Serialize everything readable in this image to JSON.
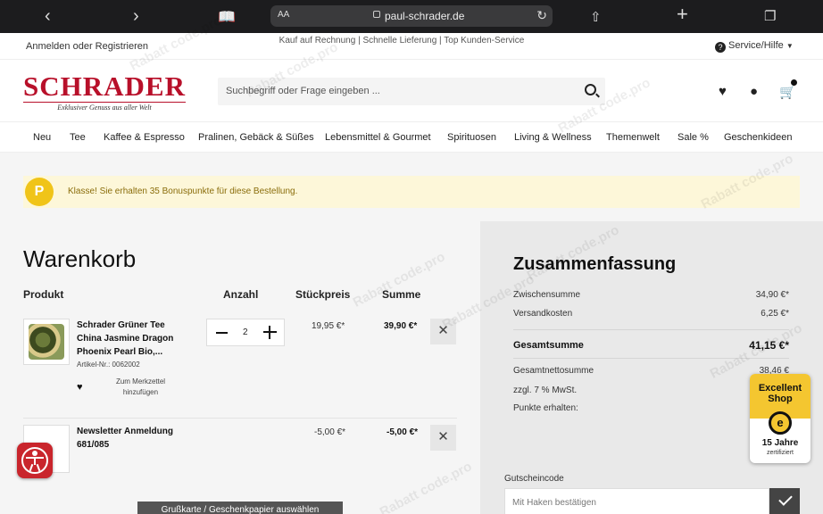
{
  "browser": {
    "text_size_label": "AA",
    "url": "paul-schrader.de",
    "icons": [
      "back-icon",
      "forward-icon",
      "bookmarks-icon",
      "lock-icon",
      "reload-icon",
      "share-icon",
      "new-tab-icon",
      "tabs-icon"
    ]
  },
  "utility": {
    "login": "Anmelden oder Registrieren",
    "promo": "Kauf auf Rechnung | Schnelle Lieferung | Top Kunden-Service",
    "service": "Service/Hilfe"
  },
  "header": {
    "logo_word": "SCHRADER",
    "logo_tagline": "Exklusiver Genuss aus aller Welt",
    "search_placeholder": "Suchbegriff oder Frage eingeben ..."
  },
  "nav": [
    "Neu",
    "Tee",
    "Kaffee & Espresso",
    "Pralinen, Gebäck & Süßes",
    "Lebensmittel & Gourmet",
    "Spirituosen",
    "Living & Wellness",
    "Themenwelt",
    "Sale %",
    "Geschenkideen"
  ],
  "bonus": {
    "badge": "P",
    "text": "Klasse! Sie erhalten 35 Bonuspunkte für diese Bestellung.",
    "bg_color": "#fdf7d9",
    "badge_color": "#f0c419"
  },
  "cart": {
    "title": "Warenkorb",
    "columns": {
      "product": "Produkt",
      "quantity": "Anzahl",
      "unit_price": "Stückpreis",
      "total": "Summe"
    },
    "items": [
      {
        "name_lines": [
          "Schrader Grüner Tee",
          "China Jasmine Dragon",
          "Phoenix Pearl Bio,..."
        ],
        "article": "Artikel-Nr.: 0062002",
        "wishlist_lines": [
          "Zum Merkzettel",
          "hinzufügen"
        ],
        "quantity": "2",
        "unit_price": "19,95 €*",
        "total": "39,90 €*"
      },
      {
        "name_lines": [
          "Newsletter Anmeldung",
          "681/085"
        ],
        "unit_price": "-5,00 €*",
        "total": "-5,00 €*"
      }
    ],
    "gift_button": "Grußkarte / Geschenkpapier auswählen"
  },
  "summary": {
    "title": "Zusammenfassung",
    "subtotal_label": "Zwischensumme",
    "subtotal": "34,90 €*",
    "shipping_label": "Versandkosten",
    "shipping": "6,25 €*",
    "total_label": "Gesamtsumme",
    "total": "41,15 €*",
    "net_label": "Gesamtnettosumme",
    "net": "38,46 €",
    "vat_label": "zzgl. 7 % MwSt.",
    "points_label": "Punkte erhalten:",
    "coupon_label": "Gutscheincode",
    "coupon_placeholder": "Mit Haken bestätigen"
  },
  "badge": {
    "line1": "Excellent",
    "line2": "Shop",
    "seal": "e",
    "years": "15 Jahre",
    "cert": "zertifiziert"
  },
  "watermark": "Rabatt code.pro",
  "colors": {
    "brand": "#b8102a",
    "summary_bg": "#e9e9e9"
  }
}
